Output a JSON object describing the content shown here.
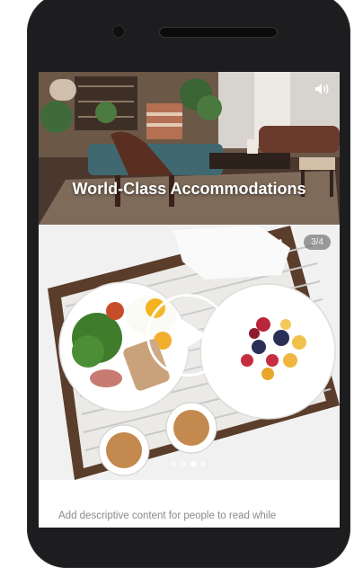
{
  "hero": {
    "title": "World-Class Accommodations",
    "sound_icon": "speaker-volume-icon"
  },
  "media": {
    "counter": "3/4",
    "play_icon": "play-icon",
    "slides_total": 4,
    "active_slide": 3
  },
  "description": {
    "text": "Add descriptive content for people to read while"
  },
  "colors": {
    "phone_body": "#1d1d1f",
    "screen_bg": "#ffffff",
    "text_muted": "#8a8a8a",
    "counter_bg": "#505050"
  }
}
